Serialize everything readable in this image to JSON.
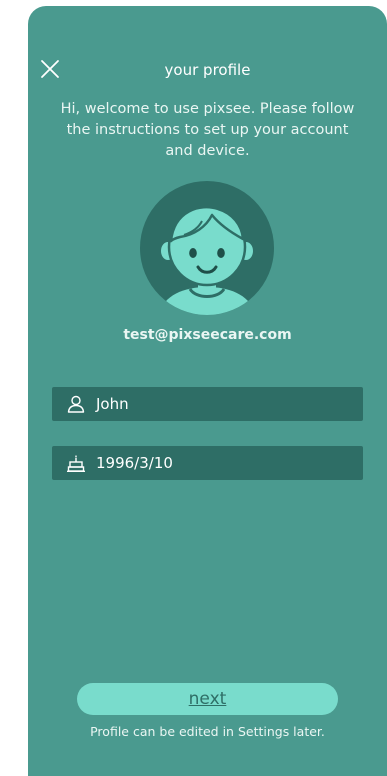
{
  "header": {
    "title": "your profile",
    "close_icon": "close-icon"
  },
  "welcome_text": "Hi, welcome to use pixsee. Please follow the instructions to set up your account and device.",
  "profile": {
    "avatar_icon": "child-avatar-icon",
    "email": "test@pixseecare.com"
  },
  "fields": {
    "name": {
      "icon": "person-icon",
      "value": "John"
    },
    "birthday": {
      "icon": "birthday-cake-icon",
      "value": "1996/3/10"
    }
  },
  "footer": {
    "next_label": "next",
    "hint": "Profile can be edited in Settings later."
  },
  "colors": {
    "card_bg": "#4a9a8f",
    "field_bg": "#2e6e66",
    "button_bg": "#79dccc",
    "avatar_dark": "#2e6e66",
    "avatar_face": "#79dccc"
  }
}
